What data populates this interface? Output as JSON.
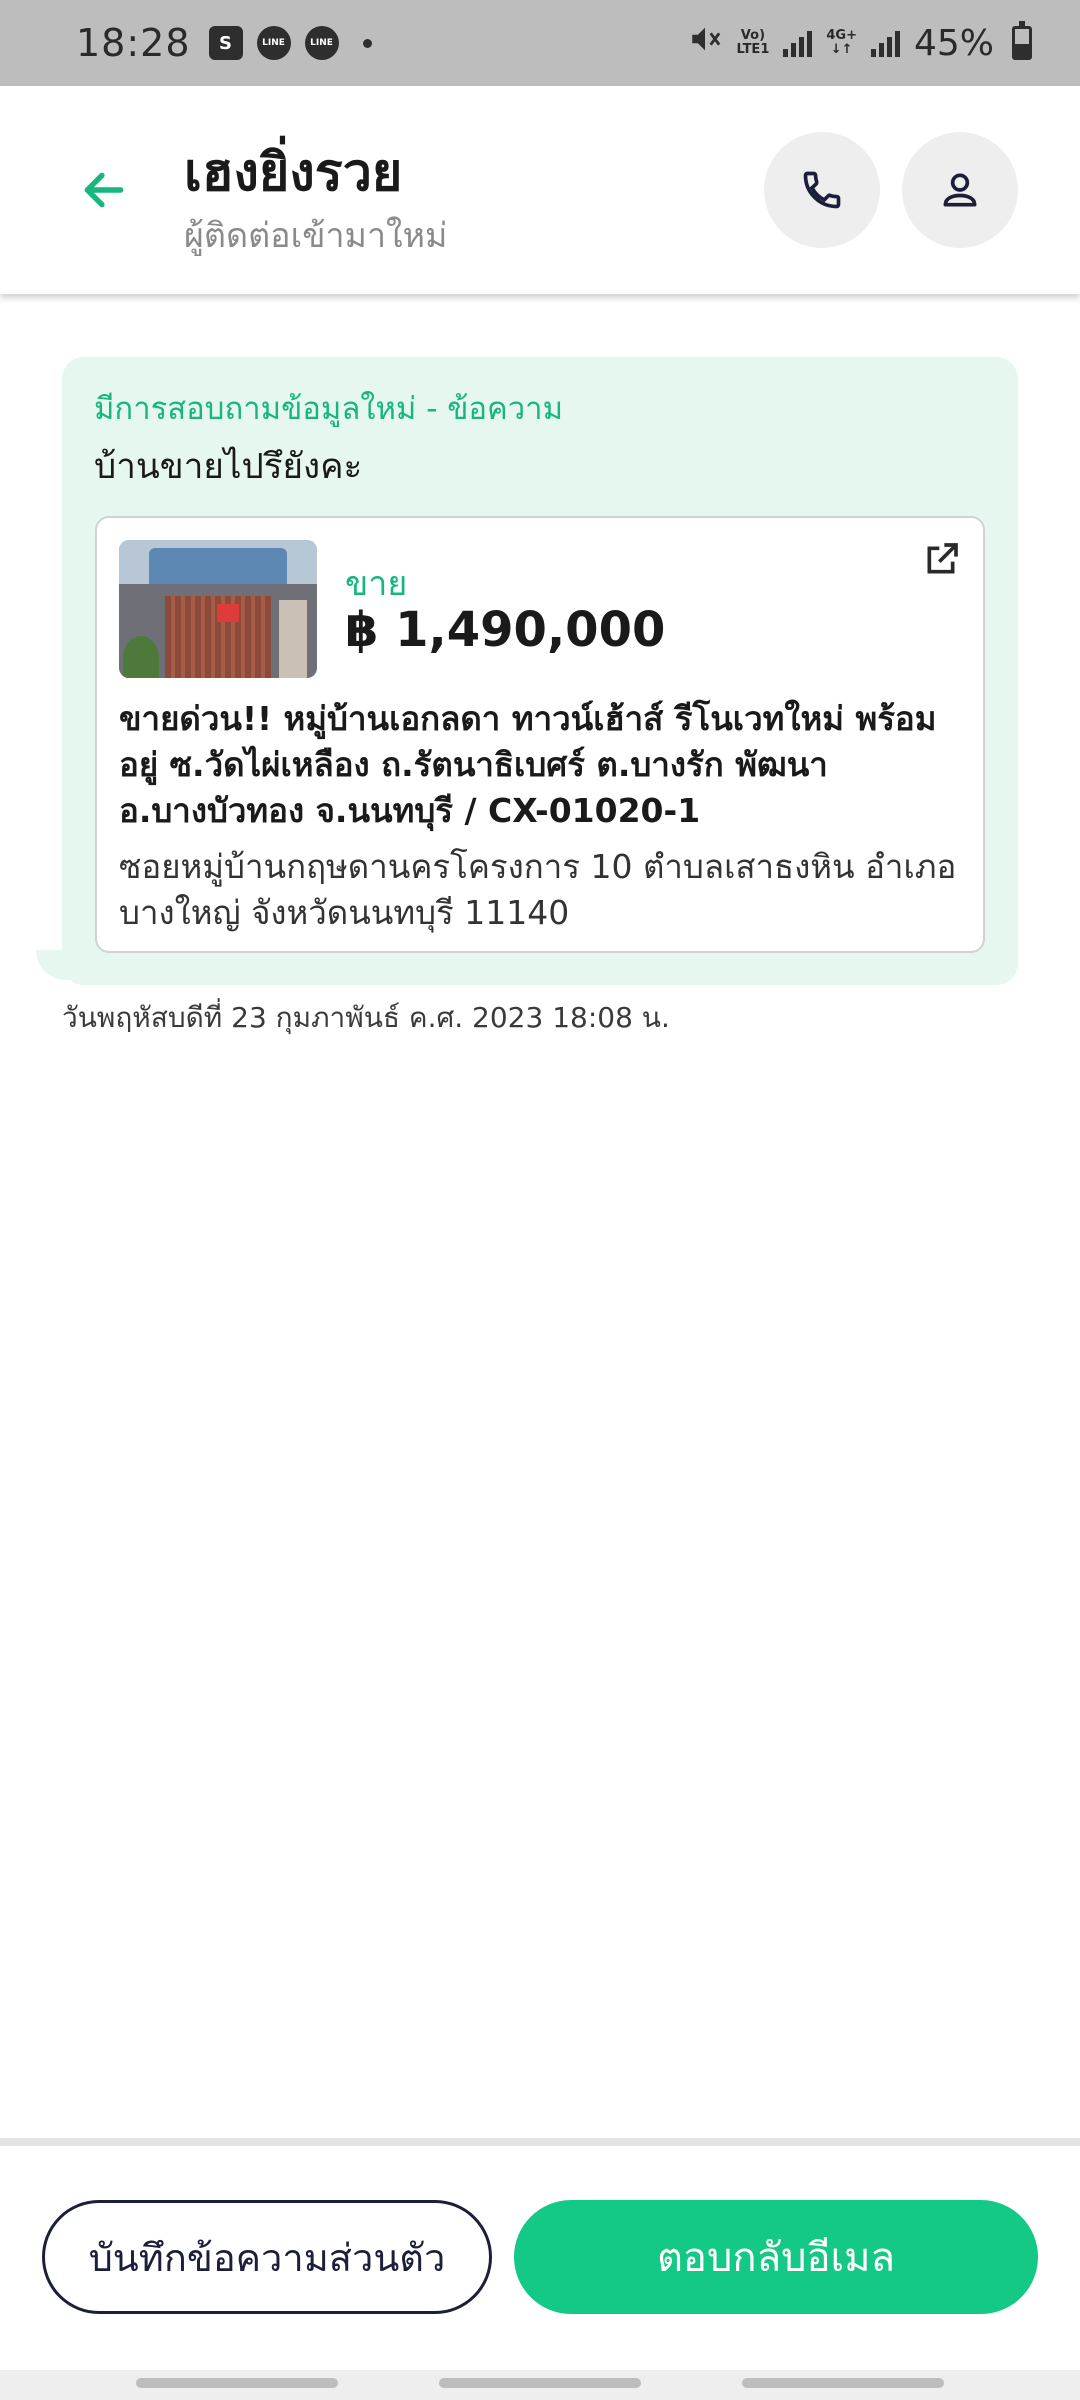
{
  "status_bar": {
    "time": "18:28",
    "net_top": "Vo)",
    "net_bottom": "LTE1",
    "net2_top": "4G+",
    "net2_bottom": "↓↑",
    "battery": "45%",
    "app_icons": [
      "shopping-bag-icon",
      "line-icon",
      "line-icon"
    ],
    "app_icon_labels": [
      "S",
      "LINE",
      "LINE"
    ]
  },
  "header": {
    "title": "เฮงยิ่งรวย",
    "subtitle": "ผู้ติดต่อเข้ามาใหม่",
    "accent_color": "#16b67d"
  },
  "message": {
    "heading": "มีการสอบถามข้อมูลใหม่ - ข้อความ",
    "text": "บ้านขายไปรึยังคะ",
    "timestamp": "วันพฤหัสบดีที่ 23 กุมภาพันธ์ ค.ศ. 2023 18:08 น.",
    "bubble_color": "#e6f7f0"
  },
  "listing": {
    "type": "ขาย",
    "price": "฿ 1,490,000",
    "title": "ขายด่วน!! หมู่บ้านเอกลดา ทาวน์เฮ้าส์ รีโนเวทใหม่ พร้อมอยู่ ซ.วัดไผ่เหลือง ถ.รัตนาธิเบศร์ ต.บางรัก พัฒนา อ.บางบัวทอง จ.นนทบุรี / CX-01020-1",
    "address": "ซอยหมู่บ้านกฤษดานครโครงการ 10 ตำบลเสาธงหิน อำเภอบางใหญ่ จังหวัดนนทบุรี 11140"
  },
  "actions": {
    "note_label": "บันทึกข้อความส่วนตัว",
    "reply_label": "ตอบกลับอีเมล",
    "reply_color": "#14c986"
  }
}
